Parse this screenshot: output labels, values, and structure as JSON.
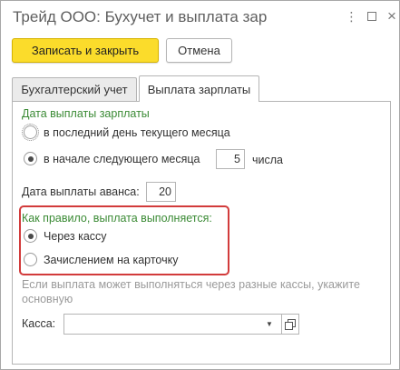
{
  "window": {
    "title": "Трейд ООО: Бухучет и выплата зар",
    "more_glyph": "⋮",
    "close_glyph": "×",
    "icons": [
      "more-icon",
      "maximize-icon",
      "close-icon"
    ]
  },
  "toolbar": {
    "save_close_label": "Записать и закрыть",
    "cancel_label": "Отмена"
  },
  "tabs": [
    {
      "label": "Бухгалтерский учет",
      "active": false
    },
    {
      "label": "Выплата зарплаты",
      "active": true
    }
  ],
  "salary_date": {
    "group_title": "Дата выплаты зарплаты",
    "option_last_day": "в последний день текущего месяца",
    "option_next_month": "в начале следующего месяца",
    "selected": "next_month",
    "day_value": "5",
    "day_suffix": "числа"
  },
  "advance": {
    "label": "Дата выплаты аванса:",
    "value": "20"
  },
  "payment_method": {
    "group_title": "Как правило, выплата выполняется:",
    "option_cash": "Через кассу",
    "option_card": "Зачислением на карточку",
    "selected": "cash",
    "highlight_color": "#d23b3b"
  },
  "hint_text": "Если выплата может выполняться через разные кассы, укажите основную",
  "cash_desk": {
    "label": "Касса:",
    "value": "",
    "dropdown_glyph": "▼"
  },
  "colors": {
    "primary_button": "#fbdc2b",
    "group_title": "#3a8a34"
  }
}
